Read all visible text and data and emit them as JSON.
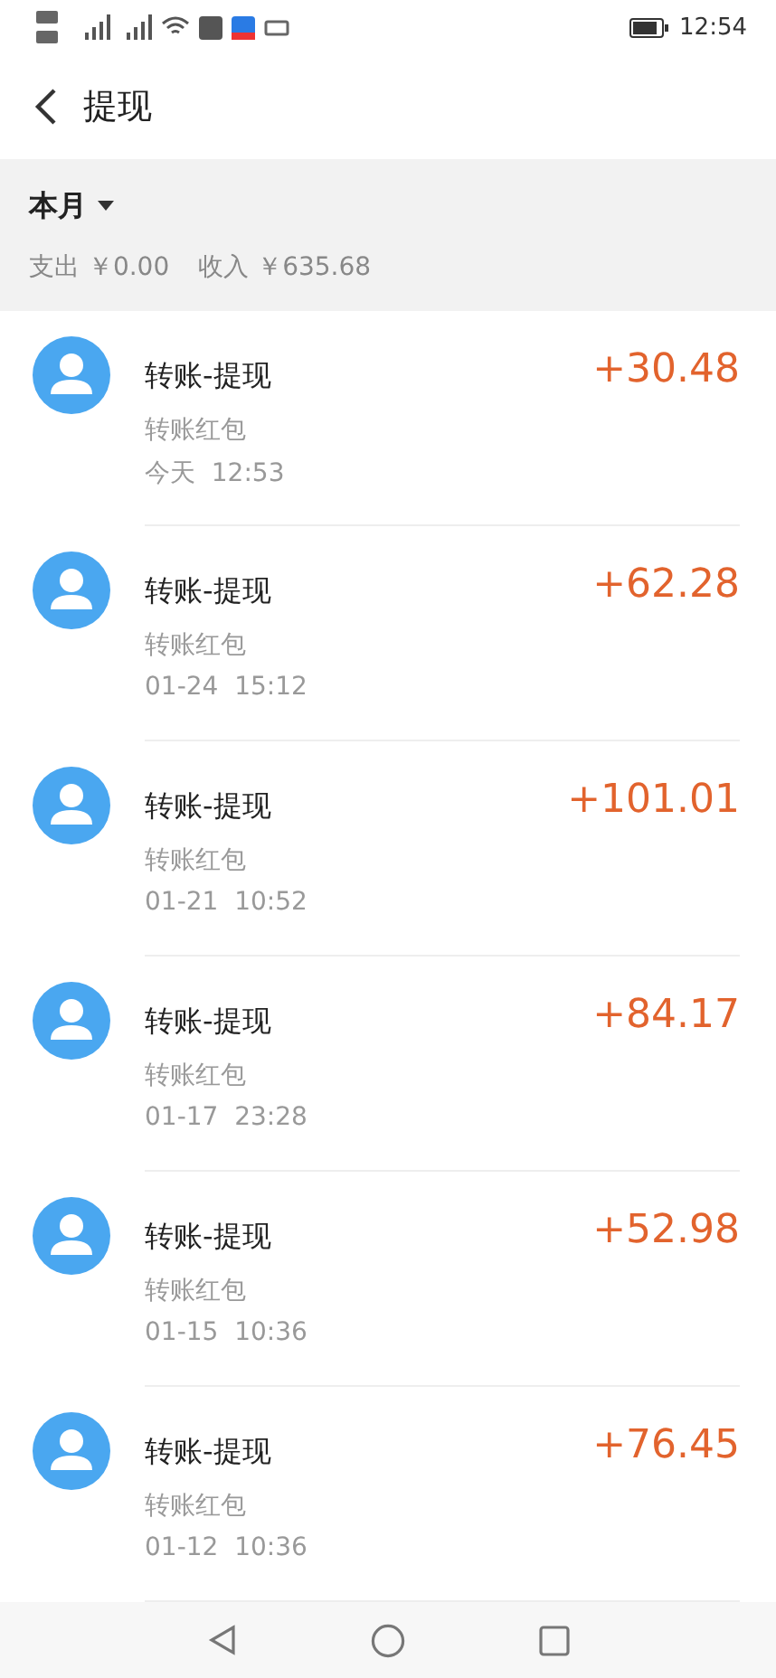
{
  "status_bar": {
    "time": "12:54"
  },
  "header": {
    "title": "提现"
  },
  "summary": {
    "period": "本月",
    "expense": "支出 ￥0.00",
    "income": "收入 ￥635.68"
  },
  "records": [
    {
      "title": "转账-提现",
      "subtitle": "转账红包",
      "time": "今天  12:53",
      "amount": "+30.48"
    },
    {
      "title": "转账-提现",
      "subtitle": "转账红包",
      "time": "01-24  15:12",
      "amount": "+62.28"
    },
    {
      "title": "转账-提现",
      "subtitle": "转账红包",
      "time": "01-21  10:52",
      "amount": "+101.01"
    },
    {
      "title": "转账-提现",
      "subtitle": "转账红包",
      "time": "01-17  23:28",
      "amount": "+84.17"
    },
    {
      "title": "转账-提现",
      "subtitle": "转账红包",
      "time": "01-15  10:36",
      "amount": "+52.98"
    },
    {
      "title": "转账-提现",
      "subtitle": "转账红包",
      "time": "01-12  10:36",
      "amount": "+76.45"
    }
  ]
}
